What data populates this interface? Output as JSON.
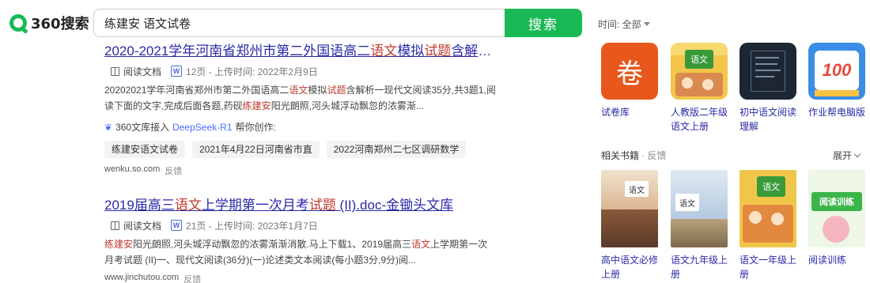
{
  "header": {
    "logo": "360搜索",
    "query": "练建安 语文试卷",
    "search_button": "搜索",
    "time_filter": "时间: 全部"
  },
  "results": [
    {
      "title_parts": [
        "2020-2021学年河南省郑州市第二外国语高二",
        "语文",
        "模拟",
        "试题",
        "含解析…"
      ],
      "doc_type": "阅读文档",
      "meta": "12页 - 上传时间: 2022年2月9日",
      "snippet_parts": [
        "20202021学年河南省郑州市第二外国语高二",
        "语文",
        "模拟",
        "试题",
        "含解析一现代文阅读35分,共3题1,阅读下面的文字,完成后面各题,药砚",
        "练建安",
        "阳光朗照,河头城浮动飘忽的浓雾渐..."
      ],
      "deepseek": {
        "prefix": "360文库接入",
        "link": "DeepSeek-R1",
        "suffix": "帮你创作:"
      },
      "chips": [
        "练建安语文试卷",
        "2021年4月22日河南省市直",
        "2022河南郑州二七区调研数学"
      ],
      "source": "wenku.so.com",
      "feedback": "反馈"
    },
    {
      "title_parts": [
        "2019届高三",
        "语文",
        "上学期第一次月考",
        "试题",
        " (II).doc-金锄头文库"
      ],
      "doc_type": "阅读文档",
      "meta": "21页 - 上传时间: 2023年1月7日",
      "snippet_parts": [
        "练建安",
        "阳光朗照,河头城浮动飘忽的浓雾渐渐消散.马上下载1、2019届高三",
        "语文",
        "上学期第一次月考试题 (II)一、现代文阅读(36分)(一)论述类文本阅读(每小题3分,9分)阅..."
      ],
      "source": "www.jinchutou.com",
      "feedback": "反馈"
    }
  ],
  "sidebar": {
    "apps": [
      {
        "label": "试卷库",
        "icon": "juan-app-icon",
        "glyph": "卷",
        "color": "#e8581c"
      },
      {
        "label": "人教版二年级语文上册",
        "icon": "textbook-cover-icon",
        "glyph": "语文",
        "color": "#f3c64a"
      },
      {
        "label": "初中语文阅读理解",
        "icon": "reading-app-icon",
        "glyph": "",
        "color": "#1d2633"
      },
      {
        "label": "作业帮电脑版",
        "icon": "zuoyebang-app-icon",
        "glyph": "100",
        "color": "#3a8ee6"
      }
    ],
    "books_title": "相关书籍",
    "books_feedback": "· 反馈",
    "expand": "展开",
    "books": [
      {
        "label": "高中语文必修上册",
        "icon": "book-cover-icon",
        "glyph": "语文",
        "color": "#c98b5a"
      },
      {
        "label": "语文九年级上册",
        "icon": "book-cover-icon",
        "glyph": "语文",
        "color": "#9bb8d6"
      },
      {
        "label": "语文一年级上册",
        "icon": "book-cover-icon",
        "glyph": "语文",
        "color": "#f0c64a"
      },
      {
        "label": "阅读训练",
        "icon": "book-cover-icon",
        "glyph": "阅读训练",
        "color": "#3bb54a"
      }
    ]
  }
}
